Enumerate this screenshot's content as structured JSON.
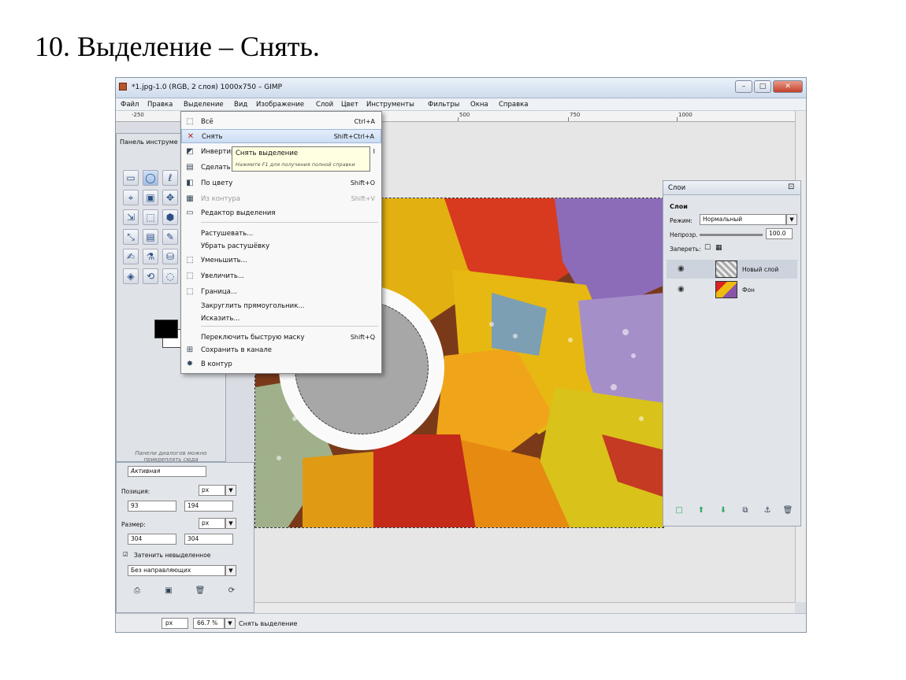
{
  "slide": {
    "title": "10. Выделение – Снять."
  },
  "window": {
    "title": "*1.jpg-1.0 (RGB, 2 слоя) 1000x750 – GIMP",
    "min_label": "–",
    "max_label": "□",
    "close_label": "✕"
  },
  "menubar": {
    "items": [
      "Файл",
      "Правка",
      "Выделение",
      "Вид",
      "Изображение",
      "Слой",
      "Цвет",
      "Инструменты",
      "Фильтры",
      "Окна",
      "Справка"
    ]
  },
  "ruler": {
    "labels": [
      "-250",
      "500",
      "750",
      "1000"
    ]
  },
  "toolbox": {
    "title": "Панель инструме",
    "tools": [
      "▭",
      "◯",
      "ℓ",
      "✂",
      "⌖",
      "▣",
      "✥",
      "⤢",
      "⇲",
      "⬚",
      "⬢",
      "⧉",
      "⤡",
      "▤",
      "✎",
      "✒",
      "✍",
      "⚗",
      "⛁",
      "✹",
      "◈",
      "⟲",
      "◌",
      "◉"
    ],
    "hint": "Панели диалогов можно прикреплять сюда"
  },
  "tool_options": {
    "mode_value": "Активная",
    "position_label": "Позиция:",
    "pos_unit": "px",
    "pos_x": "93",
    "pos_y": "194",
    "size_label": "Размер:",
    "size_unit": "px",
    "size_w": "304",
    "size_h": "304",
    "checkbox_label": "Затенить невыделенное",
    "guides_value": "Без направляющих",
    "buttons": [
      "⎙",
      "▣",
      "🗑",
      "⟳"
    ]
  },
  "menu": {
    "items": [
      {
        "icon": "⬚",
        "label": "Всё",
        "shortcut": "Ctrl+A"
      },
      {
        "icon": "✕",
        "label": "Снять",
        "shortcut": "Shift+Ctrl+A"
      },
      {
        "icon": "◩",
        "label": "Инвертир",
        "shortcut": "I"
      },
      {
        "icon": "▤",
        "label": "Сделать",
        "shortcut": ""
      },
      {
        "icon": "◧",
        "label": "По цвету",
        "shortcut": "Shift+O"
      },
      {
        "icon": "▦",
        "label": "Из контура",
        "shortcut": "Shift+V"
      },
      {
        "icon": "▭",
        "label": "Редактор выделения",
        "shortcut": ""
      },
      {
        "icon": "",
        "label": "Растушевать...",
        "shortcut": ""
      },
      {
        "icon": "",
        "label": "Убрать растушёвку",
        "shortcut": ""
      },
      {
        "icon": "⬚",
        "label": "Уменьшить...",
        "shortcut": ""
      },
      {
        "icon": "⬚",
        "label": "Увеличить...",
        "shortcut": ""
      },
      {
        "icon": "⬚",
        "label": "Граница...",
        "shortcut": ""
      },
      {
        "icon": "",
        "label": "Закруглить прямоугольник...",
        "shortcut": ""
      },
      {
        "icon": "",
        "label": "Исказить...",
        "shortcut": ""
      },
      {
        "icon": "",
        "label": "Переключить быструю маску",
        "shortcut": "Shift+Q"
      },
      {
        "icon": "⊞",
        "label": "Сохранить в канале",
        "shortcut": ""
      },
      {
        "icon": "✸",
        "label": "В контур",
        "shortcut": ""
      }
    ]
  },
  "tooltip": {
    "title": "Снять выделение",
    "hint": "Нажмите F1 для получения полной справки"
  },
  "layers": {
    "panel_title": "Слои",
    "tab_title": "Слои",
    "mode_label": "Режим:",
    "mode_value": "Нормальный",
    "opacity_label": "Непрозр.",
    "opacity_value": "100.0",
    "lock_label": "Запереть:",
    "rows": [
      {
        "name": "Новый слой"
      },
      {
        "name": "Фон"
      }
    ],
    "buttons": [
      "□",
      "⬆",
      "⬇",
      "⧉",
      "⚓",
      "🗑"
    ]
  },
  "status": {
    "unit": "px",
    "zoom": "66.7 %",
    "message": "Снять выделение"
  },
  "colors": {
    "accent": "#cbdcf3",
    "tooltip_bg": "#ffffe1",
    "fg_color": "#000000",
    "bg_color": "#ffffff"
  }
}
